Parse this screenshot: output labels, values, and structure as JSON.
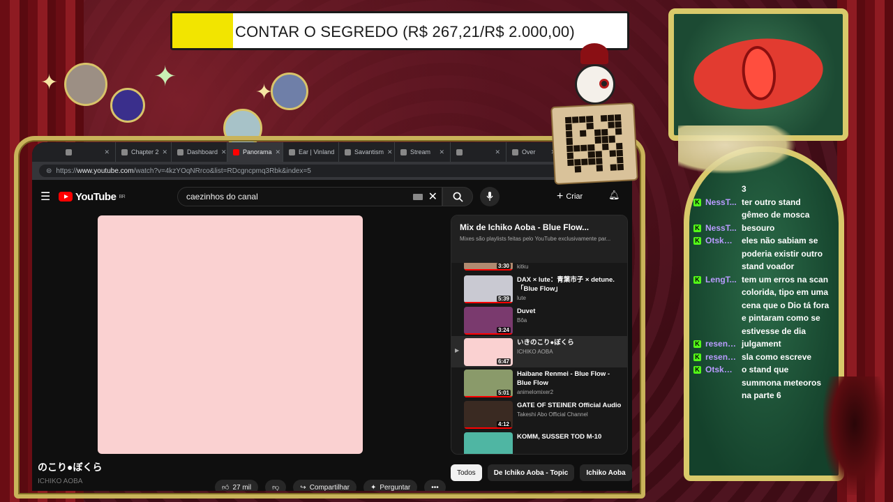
{
  "goal": {
    "text": "CONTAR O SEGREDO (R$ 267,21/R$ 2.000,00)",
    "progress_fraction": 0.1336,
    "fill_color": "#f2e500"
  },
  "browser": {
    "tabs": [
      {
        "label": "",
        "icon": "app-icon"
      },
      {
        "label": "Chapter 2",
        "icon": "page-icon"
      },
      {
        "label": "Dashboard",
        "icon": "globe-icon"
      },
      {
        "label": "Panorama",
        "icon": "youtube-icon",
        "active": true
      },
      {
        "label": "Ear | Vinland",
        "icon": "page-icon"
      },
      {
        "label": "Savantism",
        "icon": "wiki-icon"
      },
      {
        "label": "Stream",
        "icon": "page-icon"
      },
      {
        "label": "",
        "icon": "page-icon"
      },
      {
        "label": "Over",
        "icon": "x-icon"
      }
    ],
    "url_prefix": "https://",
    "url_host": "www.youtube.com",
    "url_path": "/watch?v=4kzYOqNRrco&list=RDcgncpmq3Rbk&index=5"
  },
  "youtube": {
    "logo_text": "YouTube",
    "region": "BR",
    "search_value": "caezinhos do canal",
    "create_label": "Criar"
  },
  "video": {
    "title": "のこり●ぼくら",
    "channel": "ICHIKO AOBA",
    "likes": "27 mil",
    "share_label": "Compartilhar",
    "ask_label": "Perguntar"
  },
  "playlist": {
    "title": "Mix de Ichiko Aoba - Blue Flow...",
    "subtitle": "Mixes são playlists feitas pelo YouTube exclusivamente par...",
    "items": [
      {
        "title": "",
        "channel": "kitku",
        "duration": "3:30",
        "thumb": "#b08a70",
        "partial": true
      },
      {
        "title": "DAX × lute：青葉市子 × detune.「Blue Flow」",
        "channel": "lute",
        "duration": "5:39",
        "thumb": "#c9c9d2"
      },
      {
        "title": "Duvet",
        "channel": "Bôa",
        "duration": "3:24",
        "thumb": "#7a3a6e"
      },
      {
        "title": "いきのこり●ぼくら",
        "channel": "ICHIKO AOBA",
        "duration": "6:47",
        "thumb": "#fad1d1",
        "current": true
      },
      {
        "title": "Haibane Renmei - Blue Flow - Blue Flow",
        "channel": "animelomixer2",
        "duration": "5:01",
        "thumb": "#8a9a6a"
      },
      {
        "title": "GATE OF STEINER Official Audio",
        "channel": "Takeshi Abo Official Channel",
        "duration": "4:12",
        "thumb": "#3a2a22"
      },
      {
        "title": "KOMM, SUSSER TOD M-10",
        "channel": "",
        "duration": "",
        "thumb": "#4fb6a3"
      }
    ]
  },
  "chips": [
    {
      "label": "Todos",
      "active": true
    },
    {
      "label": "De Ichiko Aoba - Topic",
      "active": false
    },
    {
      "label": "Ichiko Aoba",
      "active": false
    }
  ],
  "chat": {
    "messages": [
      {
        "user": "",
        "text": "3",
        "badge": false
      },
      {
        "user": "NessT...",
        "text": "ter outro stand gêmeo de mosca",
        "badge": true
      },
      {
        "user": "NessT...",
        "text": "besouro",
        "badge": true
      },
      {
        "user": "Otskuna",
        "text": "eles não sabiam se poderia existir outro stand voador",
        "badge": true
      },
      {
        "user": "LengT...",
        "text": "tem um erros na scan colorida, tipo em uma cena que o Dio tá fora e pintaram como se estivesse de dia",
        "badge": true
      },
      {
        "user": "resenh...",
        "text": "julgament",
        "badge": true
      },
      {
        "user": "resenh...",
        "text": "sla como escreve",
        "badge": true
      },
      {
        "user": "Otskuna",
        "text": "o stand que summona meteoros na parte 6",
        "badge": true
      }
    ],
    "badge_letter": "K",
    "user_color": "#b99bff",
    "badge_color": "#53fc18"
  },
  "colors": {
    "frame_gold": "#d9c96a",
    "youtube_red": "#ff0000",
    "curtain_red": "#8e1b22"
  }
}
